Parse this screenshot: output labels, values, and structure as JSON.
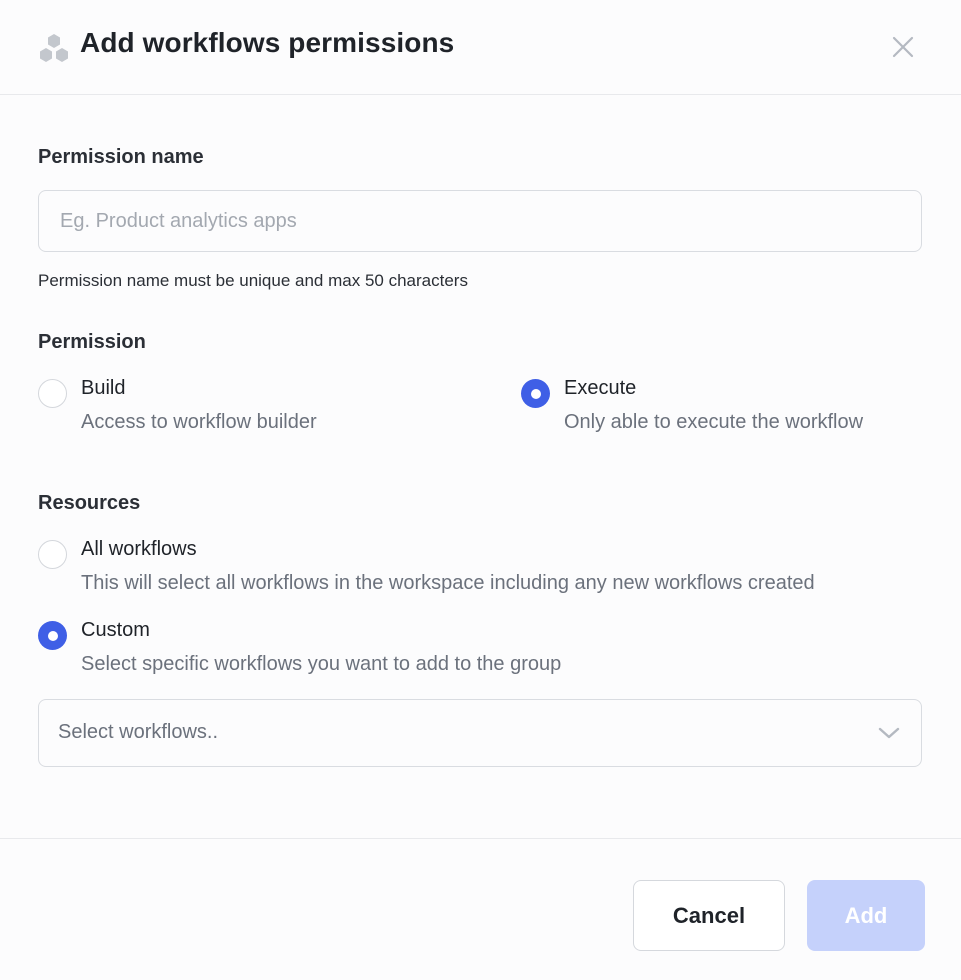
{
  "header": {
    "title": "Add workflows permissions",
    "icon": "hexagon-cluster-icon",
    "close_icon": "close-icon"
  },
  "permission_name": {
    "label": "Permission name",
    "value": "",
    "placeholder": "Eg. Product analytics apps",
    "helper": "Permission name must be unique and max 50 characters"
  },
  "permission": {
    "label": "Permission",
    "options": [
      {
        "title": "Build",
        "description": "Access to workflow builder",
        "selected": false
      },
      {
        "title": "Execute",
        "description": "Only able to execute the workflow",
        "selected": true
      }
    ]
  },
  "resources": {
    "label": "Resources",
    "options": [
      {
        "title": "All workflows",
        "description": "This will select all workflows in the workspace including any new workflows created",
        "selected": false
      },
      {
        "title": "Custom",
        "description": "Select specific workflows you want to add to the group",
        "selected": true
      }
    ],
    "select_placeholder": "Select workflows.."
  },
  "footer": {
    "cancel_label": "Cancel",
    "add_label": "Add"
  },
  "colors": {
    "accent": "#3f5fe6",
    "add_disabled": "#c5d1fb",
    "border": "#d9dce1",
    "muted_text": "#6b717c",
    "icon_gray": "#c3c7cd"
  }
}
